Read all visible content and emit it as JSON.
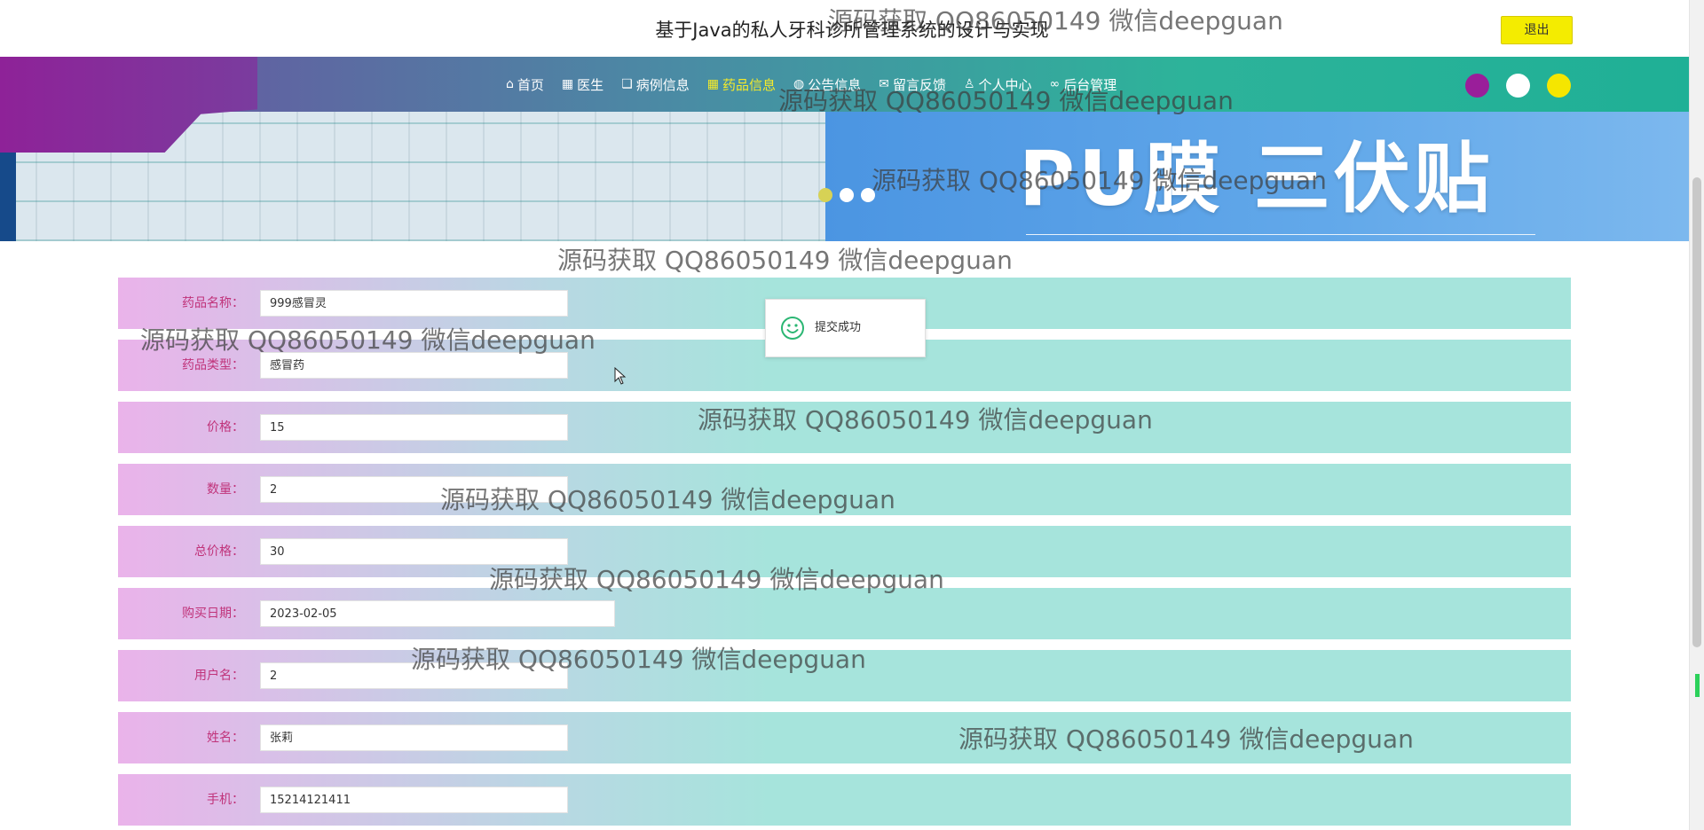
{
  "header": {
    "site_title": "基于Java的私人牙科诊所管理系统的设计与实现",
    "logout_label": "退出"
  },
  "nav": {
    "items": [
      {
        "icon": "home-icon",
        "glyph": "⌂",
        "label": "首页"
      },
      {
        "icon": "doctor-icon",
        "glyph": "▦",
        "label": "医生"
      },
      {
        "icon": "book-icon",
        "glyph": "❏",
        "label": "病例信息"
      },
      {
        "icon": "grid-icon",
        "glyph": "▦",
        "label": "药品信息",
        "active": true
      },
      {
        "icon": "globe-icon",
        "glyph": "◍",
        "label": "公告信息"
      },
      {
        "icon": "mail-icon",
        "glyph": "✉",
        "label": "留言反馈"
      },
      {
        "icon": "user-icon",
        "glyph": "♙",
        "label": "个人中心"
      },
      {
        "icon": "link-icon",
        "glyph": "∞",
        "label": "后台管理"
      }
    ],
    "theme_dots": [
      "#9a1e9a",
      "#ffffff",
      "#f5e600"
    ]
  },
  "banner": {
    "text": "PU膜 三伏贴",
    "slide_count": 3,
    "active_slide": 1
  },
  "form": {
    "rows": [
      {
        "label": "药品名称：",
        "value": "999感冒灵"
      },
      {
        "label": "药品类型：",
        "value": "感冒药"
      },
      {
        "label": "价格：",
        "value": "15"
      },
      {
        "label": "数量：",
        "value": "2"
      },
      {
        "label": "总价格：",
        "value": "30"
      },
      {
        "label": "购买日期：",
        "value": "2023-02-05"
      },
      {
        "label": "用户名：",
        "value": "2"
      },
      {
        "label": "姓名：",
        "value": "张莉"
      },
      {
        "label": "手机：",
        "value": "15214121411"
      }
    ]
  },
  "toast": {
    "message": "提交成功"
  },
  "watermark": "源码获取 QQ86050149 微信deepguan"
}
